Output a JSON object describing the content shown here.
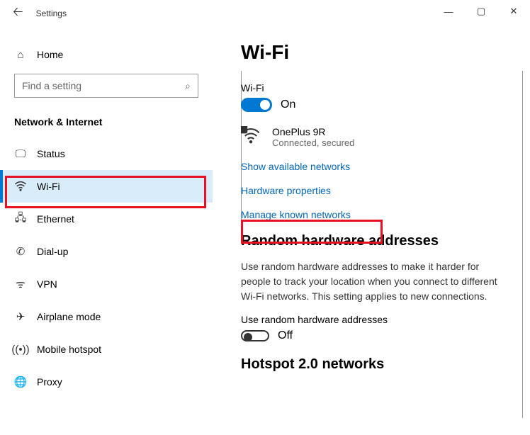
{
  "window": {
    "title": "Settings"
  },
  "sidebar": {
    "home": "Home",
    "search_placeholder": "Find a setting",
    "category": "Network & Internet",
    "items": [
      {
        "label": "Status"
      },
      {
        "label": "Wi-Fi"
      },
      {
        "label": "Ethernet"
      },
      {
        "label": "Dial-up"
      },
      {
        "label": "VPN"
      },
      {
        "label": "Airplane mode"
      },
      {
        "label": "Mobile hotspot"
      },
      {
        "label": "Proxy"
      }
    ]
  },
  "main": {
    "title": "Wi-Fi",
    "wifi_label": "Wi-Fi",
    "wifi_state": "On",
    "network": {
      "name": "OnePlus 9R",
      "status": "Connected, secured"
    },
    "links": {
      "show_available": "Show available networks",
      "hw_props": "Hardware properties",
      "manage_known": "Manage known networks"
    },
    "random_section_title": "Random hardware addresses",
    "random_desc": "Use random hardware addresses to make it harder for people to track your location when you connect to different Wi-Fi networks. This setting applies to new connections.",
    "random_toggle_label": "Use random hardware addresses",
    "random_state": "Off",
    "hotspot_title": "Hotspot 2.0 networks"
  }
}
